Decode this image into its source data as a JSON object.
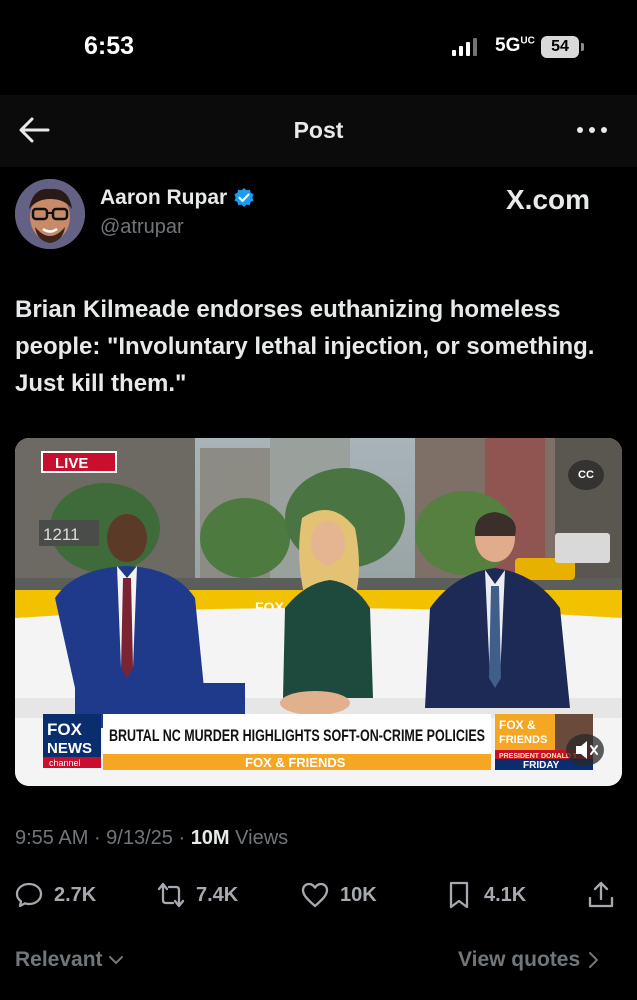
{
  "status_bar": {
    "time": "6:53",
    "network": "5G",
    "network_sup": "UC",
    "battery": "54"
  },
  "nav": {
    "title": "Post",
    "back_icon": "back-arrow-icon",
    "more_icon": "more-icon"
  },
  "author": {
    "name": "Aaron Rupar",
    "handle": "@atrupar",
    "verified": true,
    "source_label": "X.com"
  },
  "tweet": {
    "text": "Brian Kilmeade endorses euthanizing homeless people: \"Involuntary lethal injection, or something. Just kill them.\""
  },
  "video": {
    "live_label": "LIVE",
    "building_number": "1211",
    "chyron_logo_top": "FOX",
    "chyron_logo_mid": "NEWS",
    "chyron_logo_bottom": "channel",
    "headline": "BRUTAL NC MURDER HIGHLIGHTS SOFT-ON-CRIME POLICIES",
    "show_name": "FOX & FRIENDS",
    "corner_top": "FOX &",
    "corner_mid": "FRIENDS",
    "corner_ticker": "PRESIDENT DONALD T",
    "corner_day": "FRIDAY",
    "cc_label": "CC",
    "set_logo": "FOX"
  },
  "meta": {
    "time": "9:55 AM",
    "date": "9/13/25",
    "views_count": "10M",
    "views_label": "Views"
  },
  "actions": {
    "replies": "2.7K",
    "reposts": "7.4K",
    "likes": "10K",
    "bookmarks": "4.1K"
  },
  "footer": {
    "sort_label": "Relevant",
    "quotes_label": "View quotes"
  },
  "colors": {
    "verified_blue": "#1d9bf0",
    "fox_red": "#c8102e",
    "fox_blue": "#0a2d6e",
    "chyron_orange": "#f5a623"
  }
}
